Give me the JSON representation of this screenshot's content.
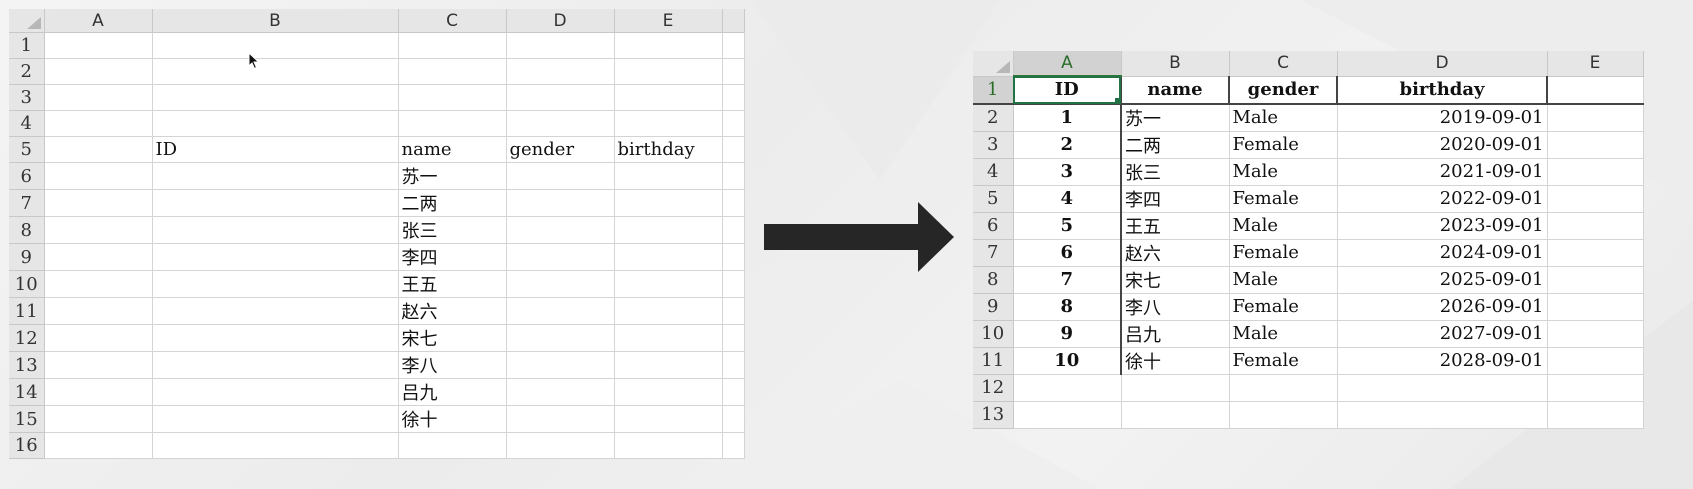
{
  "arrow": {
    "color": "#262626"
  },
  "left_sheet": {
    "columns": [
      "A",
      "B",
      "C",
      "D",
      "E"
    ],
    "rows": [
      "1",
      "2",
      "3",
      "4",
      "5",
      "6",
      "7",
      "8",
      "9",
      "10",
      "11",
      "12",
      "13",
      "14",
      "15",
      "16"
    ],
    "header_row": {
      "b": "ID",
      "c": "name",
      "d": "gender",
      "e": "birthday"
    },
    "names": [
      "苏一",
      "二两",
      "张三",
      "李四",
      "王五",
      "赵六",
      "宋七",
      "李八",
      "吕九",
      "徐十"
    ]
  },
  "right_sheet": {
    "columns": [
      "A",
      "B",
      "C",
      "D",
      "E"
    ],
    "rows": [
      "1",
      "2",
      "3",
      "4",
      "5",
      "6",
      "7",
      "8",
      "9",
      "10",
      "11",
      "12",
      "13"
    ],
    "headers": {
      "id": "ID",
      "name": "name",
      "gender": "gender",
      "birthday": "birthday"
    },
    "records": [
      {
        "id": "1",
        "name": "苏一",
        "gender": "Male",
        "birthday": "2019-09-01"
      },
      {
        "id": "2",
        "name": "二两",
        "gender": "Female",
        "birthday": "2020-09-01"
      },
      {
        "id": "3",
        "name": "张三",
        "gender": "Male",
        "birthday": "2021-09-01"
      },
      {
        "id": "4",
        "name": "李四",
        "gender": "Female",
        "birthday": "2022-09-01"
      },
      {
        "id": "5",
        "name": "王五",
        "gender": "Male",
        "birthday": "2023-09-01"
      },
      {
        "id": "6",
        "name": "赵六",
        "gender": "Female",
        "birthday": "2024-09-01"
      },
      {
        "id": "7",
        "name": "宋七",
        "gender": "Male",
        "birthday": "2025-09-01"
      },
      {
        "id": "8",
        "name": "李八",
        "gender": "Female",
        "birthday": "2026-09-01"
      },
      {
        "id": "9",
        "name": "吕九",
        "gender": "Male",
        "birthday": "2027-09-01"
      },
      {
        "id": "10",
        "name": "徐十",
        "gender": "Female",
        "birthday": "2028-09-01"
      }
    ]
  }
}
